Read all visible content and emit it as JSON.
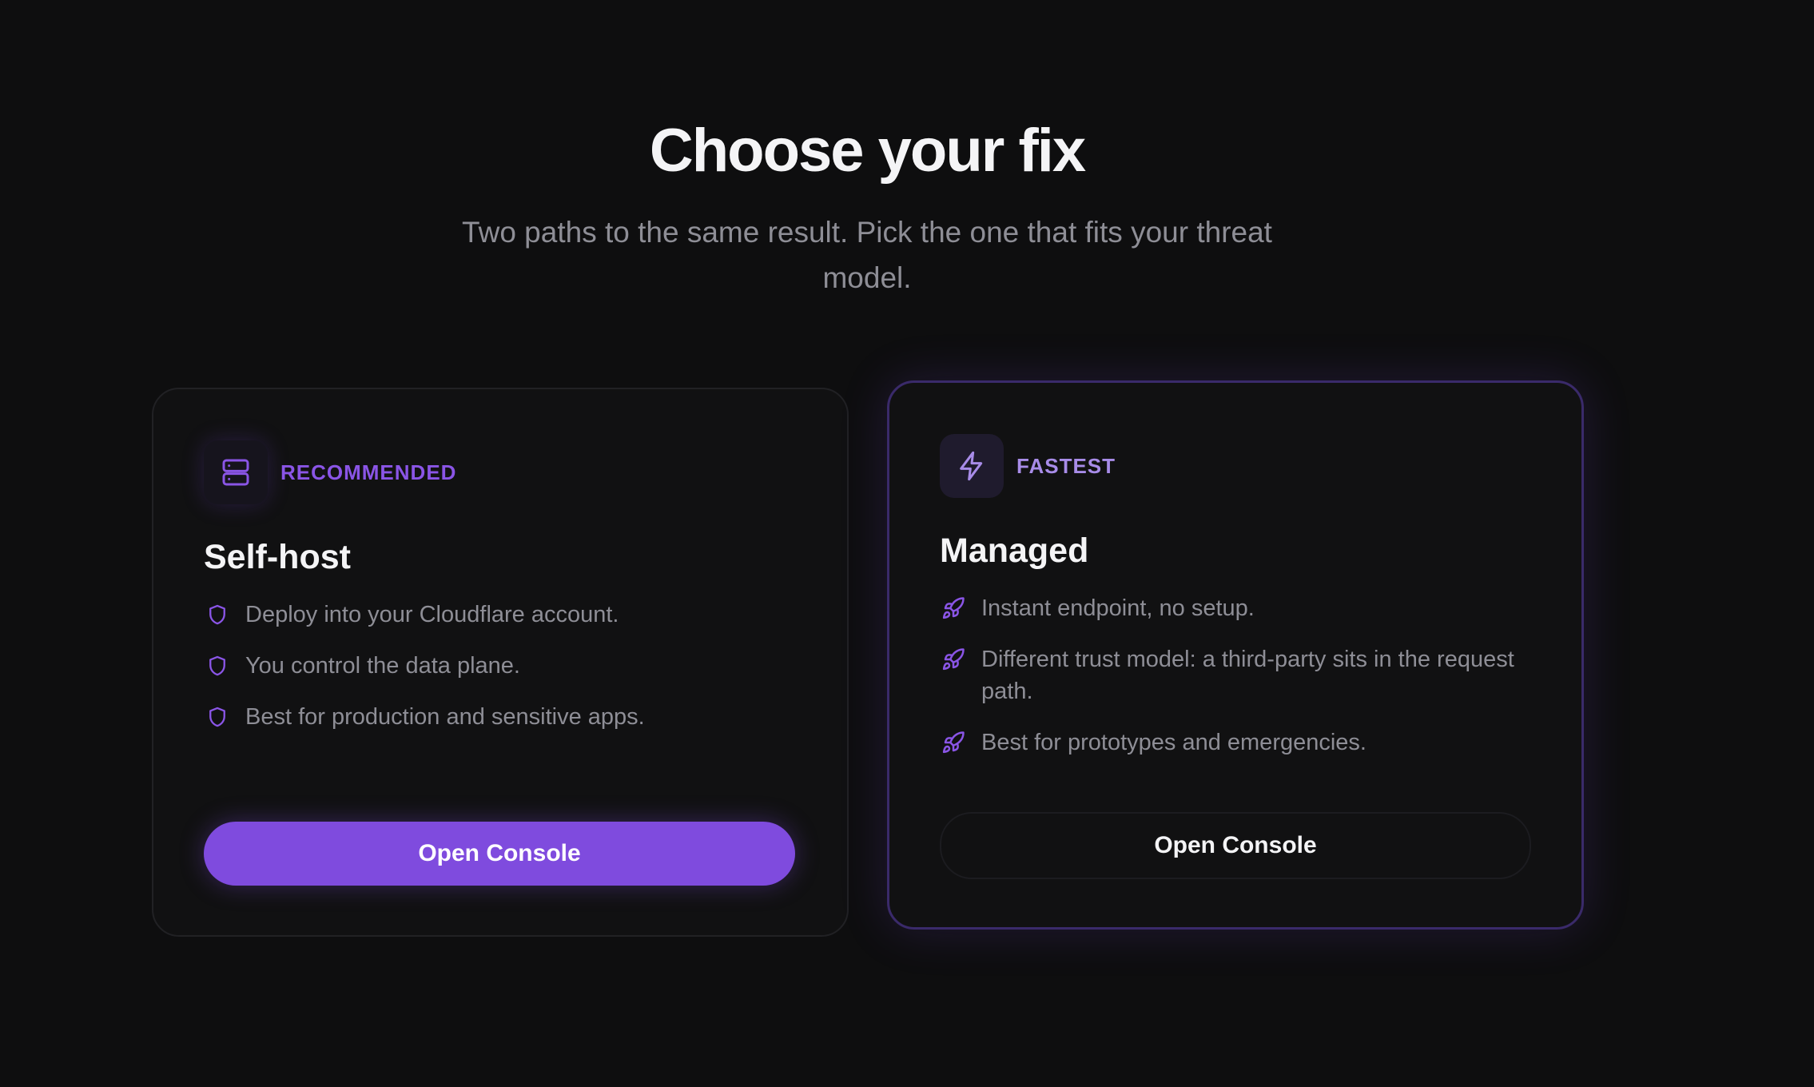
{
  "header": {
    "title": "Choose your fix",
    "subtitle": "Two paths to the same result. Pick the one that fits your threat model."
  },
  "cards": [
    {
      "badge": "RECOMMENDED",
      "badge_icon": "server-icon",
      "title": "Self-host",
      "feature_icon": "shield-icon",
      "features": [
        "Deploy into your Cloudflare account.",
        "You control the data plane.",
        "Best for production and sensitive apps."
      ],
      "button_label": "Open Console",
      "button_style": "primary"
    },
    {
      "badge": "FASTEST",
      "badge_icon": "lightning-icon",
      "title": "Managed",
      "feature_icon": "rocket-icon",
      "features": [
        "Instant endpoint, no setup.",
        "Different trust model: a third-party sits in the request path.",
        "Best for prototypes and emergencies."
      ],
      "button_label": "Open Console",
      "button_style": "secondary"
    }
  ],
  "colors": {
    "background": "#0e0e0f",
    "accent": "#7f4bde",
    "text_primary": "#f4f4f6",
    "text_muted": "#8e8e96"
  }
}
